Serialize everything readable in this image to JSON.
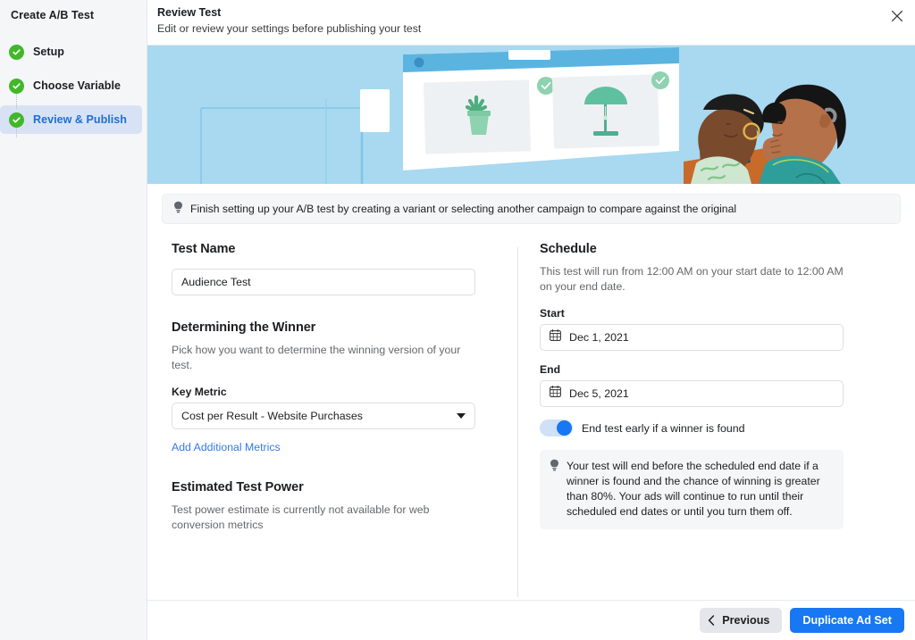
{
  "sidebar": {
    "title": "Create A/B Test",
    "steps": [
      {
        "label": "Setup",
        "icon": "check-circle-icon",
        "active": false
      },
      {
        "label": "Choose Variable",
        "icon": "check-circle-icon",
        "active": false
      },
      {
        "label": "Review & Publish",
        "icon": "check-circle-icon",
        "active": true
      }
    ]
  },
  "header": {
    "title": "Review Test",
    "subtitle": "Edit or review your settings before publishing your test",
    "close_icon": "close-icon"
  },
  "hero": {
    "alt": "Illustration of two people reviewing two product variants on a browser window",
    "background_color": "#a8d9f0"
  },
  "notice": {
    "icon": "lightbulb-icon",
    "text": "Finish setting up your A/B test by creating a variant or selecting another campaign to compare against the original"
  },
  "left_column": {
    "test_name": {
      "title": "Test Name",
      "value": "Audience Test",
      "placeholder": "Test name"
    },
    "winner": {
      "title": "Determining the Winner",
      "description": "Pick how you want to determine the winning version of your test.",
      "key_metric_label": "Key Metric",
      "key_metric_value": "Cost per Result - Website Purchases",
      "caret_icon": "chevron-down-icon",
      "add_metrics_link": "Add Additional Metrics"
    },
    "test_power": {
      "title": "Estimated Test Power",
      "description": "Test power estimate is currently not available for web conversion metrics"
    }
  },
  "right_column": {
    "schedule": {
      "title": "Schedule",
      "description": "This test will run from 12:00 AM on your start date to 12:00 AM on your end date.",
      "start_label": "Start",
      "start_value": "Dec 1, 2021",
      "end_label": "End",
      "end_value": "Dec 5, 2021",
      "calendar_icon": "calendar-icon"
    },
    "early_end": {
      "toggle_state": "on",
      "label": "End test early if a winner is found",
      "tip_icon": "lightbulb-icon",
      "tip_text": "Your test will end before the scheduled end date if a winner is found and the chance of winning is greater than 80%. Your ads will continue to run until their scheduled end dates or until you turn them off."
    }
  },
  "footer": {
    "previous_label": "Previous",
    "previous_icon": "chevron-left-icon",
    "primary_label": "Duplicate Ad Set"
  },
  "colors": {
    "accent_blue": "#1877f2",
    "link_blue": "#3578e5",
    "active_step_text": "#1d6fd4",
    "check_green": "#42b72a",
    "hero_blue": "#a8d9f0",
    "sidebar_bg": "#f5f6f7",
    "active_pill": "#d7e3f5"
  }
}
